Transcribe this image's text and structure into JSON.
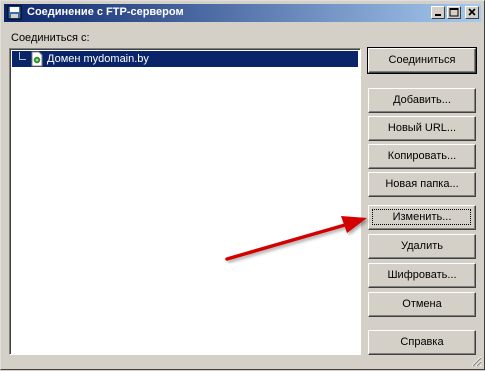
{
  "window": {
    "title": "Соединение с FTP-сервером",
    "title_buttons": [
      "minimize-icon",
      "maximize-icon",
      "close-icon"
    ]
  },
  "connect_label": "Соединиться с:",
  "tree": {
    "items": [
      {
        "label": "Домен mydomain.by",
        "selected": true,
        "icon": "ftp-site-icon"
      }
    ]
  },
  "buttons": {
    "connect": "Соединиться",
    "add": "Добавить...",
    "new_url": "Новый URL...",
    "copy": "Копировать...",
    "new_folder": "Новая папка...",
    "edit": "Изменить...",
    "delete": "Удалить",
    "encrypt": "Шифровать...",
    "cancel": "Отмена",
    "help": "Справка"
  },
  "colors": {
    "title_start": "#0a246a",
    "title_end": "#a6caf0",
    "selection": "#0a246a",
    "arrow": "#d40000"
  }
}
